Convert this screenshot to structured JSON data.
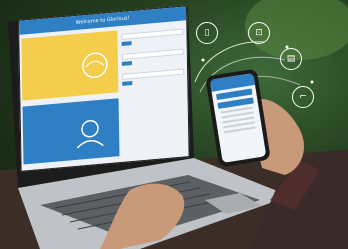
{
  "laptop": {
    "window_title": "Welcome to Glorious!",
    "yellow_card_text": "",
    "blue_card_text": ""
  },
  "icons": [
    "door-icon",
    "lock-icon",
    "gate-icon",
    "window-icon",
    "key-icon"
  ],
  "colors": {
    "accent_blue": "#2f7fc4",
    "accent_yellow": "#f4cd4a"
  }
}
